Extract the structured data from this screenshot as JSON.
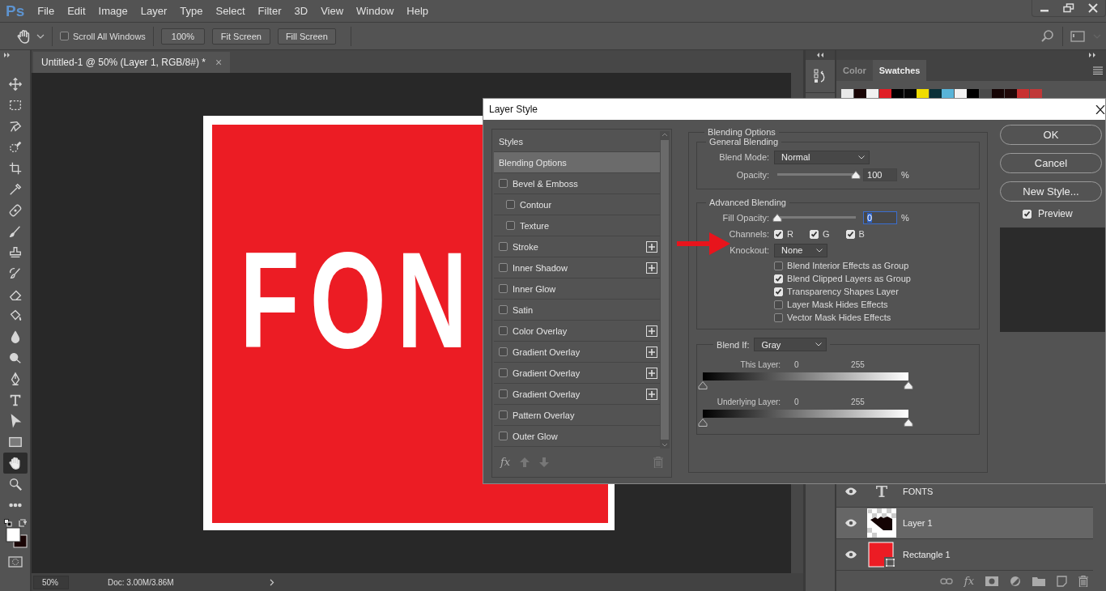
{
  "app": {
    "logo": "Ps",
    "menu": [
      "File",
      "Edit",
      "Image",
      "Layer",
      "Type",
      "Select",
      "Filter",
      "3D",
      "View",
      "Window",
      "Help"
    ]
  },
  "options_bar": {
    "scroll_all_windows": {
      "label": "Scroll All Windows",
      "checked": false
    },
    "buttons": [
      "100%",
      "Fit Screen",
      "Fill Screen"
    ]
  },
  "tools": [
    {
      "kind": "move",
      "selected": false
    },
    {
      "kind": "marquee",
      "selected": false
    },
    {
      "kind": "lasso",
      "selected": false
    },
    {
      "kind": "quick-select",
      "selected": false
    },
    {
      "kind": "crop",
      "selected": false
    },
    {
      "kind": "eyedropper",
      "selected": false
    },
    {
      "kind": "healing",
      "selected": false
    },
    {
      "kind": "brush",
      "selected": false
    },
    {
      "kind": "stamp",
      "selected": false
    },
    {
      "kind": "history-brush",
      "selected": false
    },
    {
      "kind": "eraser",
      "selected": false
    },
    {
      "kind": "bucket",
      "selected": false
    },
    {
      "kind": "blur",
      "selected": false
    },
    {
      "kind": "dodge",
      "selected": false
    },
    {
      "kind": "pen",
      "selected": false
    },
    {
      "kind": "type",
      "selected": false
    },
    {
      "kind": "path-select",
      "selected": false
    },
    {
      "kind": "shape",
      "selected": false
    },
    {
      "kind": "hand",
      "selected": true
    },
    {
      "kind": "zoom",
      "selected": false
    },
    {
      "kind": "more",
      "selected": false
    }
  ],
  "document": {
    "tab": {
      "title": "Untitled-1 @ 50% (Layer 1, RGB/8#) *",
      "close": "×"
    },
    "canvas_text": "FON",
    "status": {
      "zoom": "50%",
      "doc_size": "Doc: 3.00M/3.86M"
    }
  },
  "panels": {
    "tabs": [
      {
        "label": "Color",
        "selected": false
      },
      {
        "label": "Swatches",
        "selected": true
      }
    ],
    "swatches": [
      {
        "color": "#e8e8e8"
      },
      {
        "color": "#1a0606"
      },
      {
        "color": "#f0f0f0"
      },
      {
        "color": "#e01e26"
      },
      {
        "color": "#000000"
      },
      {
        "color": "#050505"
      },
      {
        "color": "#f0dc00"
      },
      {
        "color": "#0a3038"
      },
      {
        "color": "#58b4d8"
      },
      {
        "color": "#f2f2f2"
      },
      {
        "color": "#000000"
      },
      {
        "color": "#4a4a4a"
      },
      {
        "color": "#160404"
      },
      {
        "color": "#200808"
      },
      {
        "color": "#c83030"
      },
      {
        "color": "#c03838"
      }
    ],
    "layers": [
      {
        "name": "FONTS",
        "kind": "text",
        "visible": true,
        "selected": false
      },
      {
        "name": "Layer 1",
        "kind": "pixel",
        "visible": true,
        "selected": true
      },
      {
        "name": "Rectangle 1",
        "kind": "shape",
        "visible": true,
        "selected": false
      }
    ],
    "footer_fx": "fx"
  },
  "dialog": {
    "title": "Layer Style",
    "styles": [
      {
        "label": "Styles",
        "kind": "header",
        "selected": false
      },
      {
        "label": "Blending Options",
        "kind": "option",
        "selected": true
      },
      {
        "label": "Bevel & Emboss",
        "kind": "effect",
        "checked": false,
        "selected": false,
        "addable": false,
        "children": [
          {
            "label": "Contour",
            "kind": "effect",
            "checked": false,
            "selected": false,
            "addable": false
          },
          {
            "label": "Texture",
            "kind": "effect",
            "checked": false,
            "selected": false,
            "addable": false
          }
        ]
      },
      {
        "label": "Stroke",
        "kind": "effect",
        "checked": false,
        "selected": false,
        "addable": true
      },
      {
        "label": "Inner Shadow",
        "kind": "effect",
        "checked": false,
        "selected": false,
        "addable": true
      },
      {
        "label": "Inner Glow",
        "kind": "effect",
        "checked": false,
        "selected": false,
        "addable": false
      },
      {
        "label": "Satin",
        "kind": "effect",
        "checked": false,
        "selected": false,
        "addable": false
      },
      {
        "label": "Color Overlay",
        "kind": "effect",
        "checked": false,
        "selected": false,
        "addable": true
      },
      {
        "label": "Gradient Overlay",
        "kind": "effect",
        "checked": false,
        "selected": false,
        "addable": true
      },
      {
        "label": "Gradient Overlay",
        "kind": "effect",
        "checked": false,
        "selected": false,
        "addable": true
      },
      {
        "label": "Gradient Overlay",
        "kind": "effect",
        "checked": false,
        "selected": false,
        "addable": true
      },
      {
        "label": "Pattern Overlay",
        "kind": "effect",
        "checked": false,
        "selected": false,
        "addable": false
      },
      {
        "label": "Outer Glow",
        "kind": "effect",
        "checked": false,
        "selected": false,
        "addable": false
      }
    ],
    "footer_fx": "fx",
    "blending": {
      "title": "Blending Options",
      "general": {
        "title": "General Blending",
        "blend_mode": {
          "label": "Blend Mode:",
          "value": "Normal"
        },
        "opacity": {
          "label": "Opacity:",
          "level": 1,
          "value": "100",
          "unit": "%"
        }
      },
      "advanced": {
        "title": "Advanced Blending",
        "fill_opacity": {
          "label": "Fill Opacity:",
          "level": 0,
          "value": "0",
          "unit": "%",
          "focused": true
        },
        "channels": {
          "label": "Channels:",
          "items": [
            {
              "label": "R",
              "checked": true
            },
            {
              "label": "G",
              "checked": true
            },
            {
              "label": "B",
              "checked": true
            }
          ]
        },
        "knockout": {
          "label": "Knockout:",
          "value": "None"
        },
        "options": [
          {
            "label": "Blend Interior Effects as Group",
            "checked": false
          },
          {
            "label": "Blend Clipped Layers as Group",
            "checked": true
          },
          {
            "label": "Transparency Shapes Layer",
            "checked": true
          },
          {
            "label": "Layer Mask Hides Effects",
            "checked": false
          },
          {
            "label": "Vector Mask Hides Effects",
            "checked": false
          }
        ]
      },
      "blend_if": {
        "label": "Blend If:",
        "value": "Gray",
        "sliders": [
          {
            "label": "This Layer:",
            "low": "0",
            "high": "255",
            "thumbs": [
              {
                "level": 0
              },
              {
                "level": 1
              }
            ]
          },
          {
            "label": "Underlying Layer:",
            "low": "0",
            "high": "255",
            "thumbs": [
              {
                "level": 0
              },
              {
                "level": 1
              }
            ]
          }
        ]
      }
    },
    "buttons": [
      "OK",
      "Cancel",
      "New Style..."
    ],
    "preview": {
      "label": "Preview",
      "checked": true
    }
  }
}
